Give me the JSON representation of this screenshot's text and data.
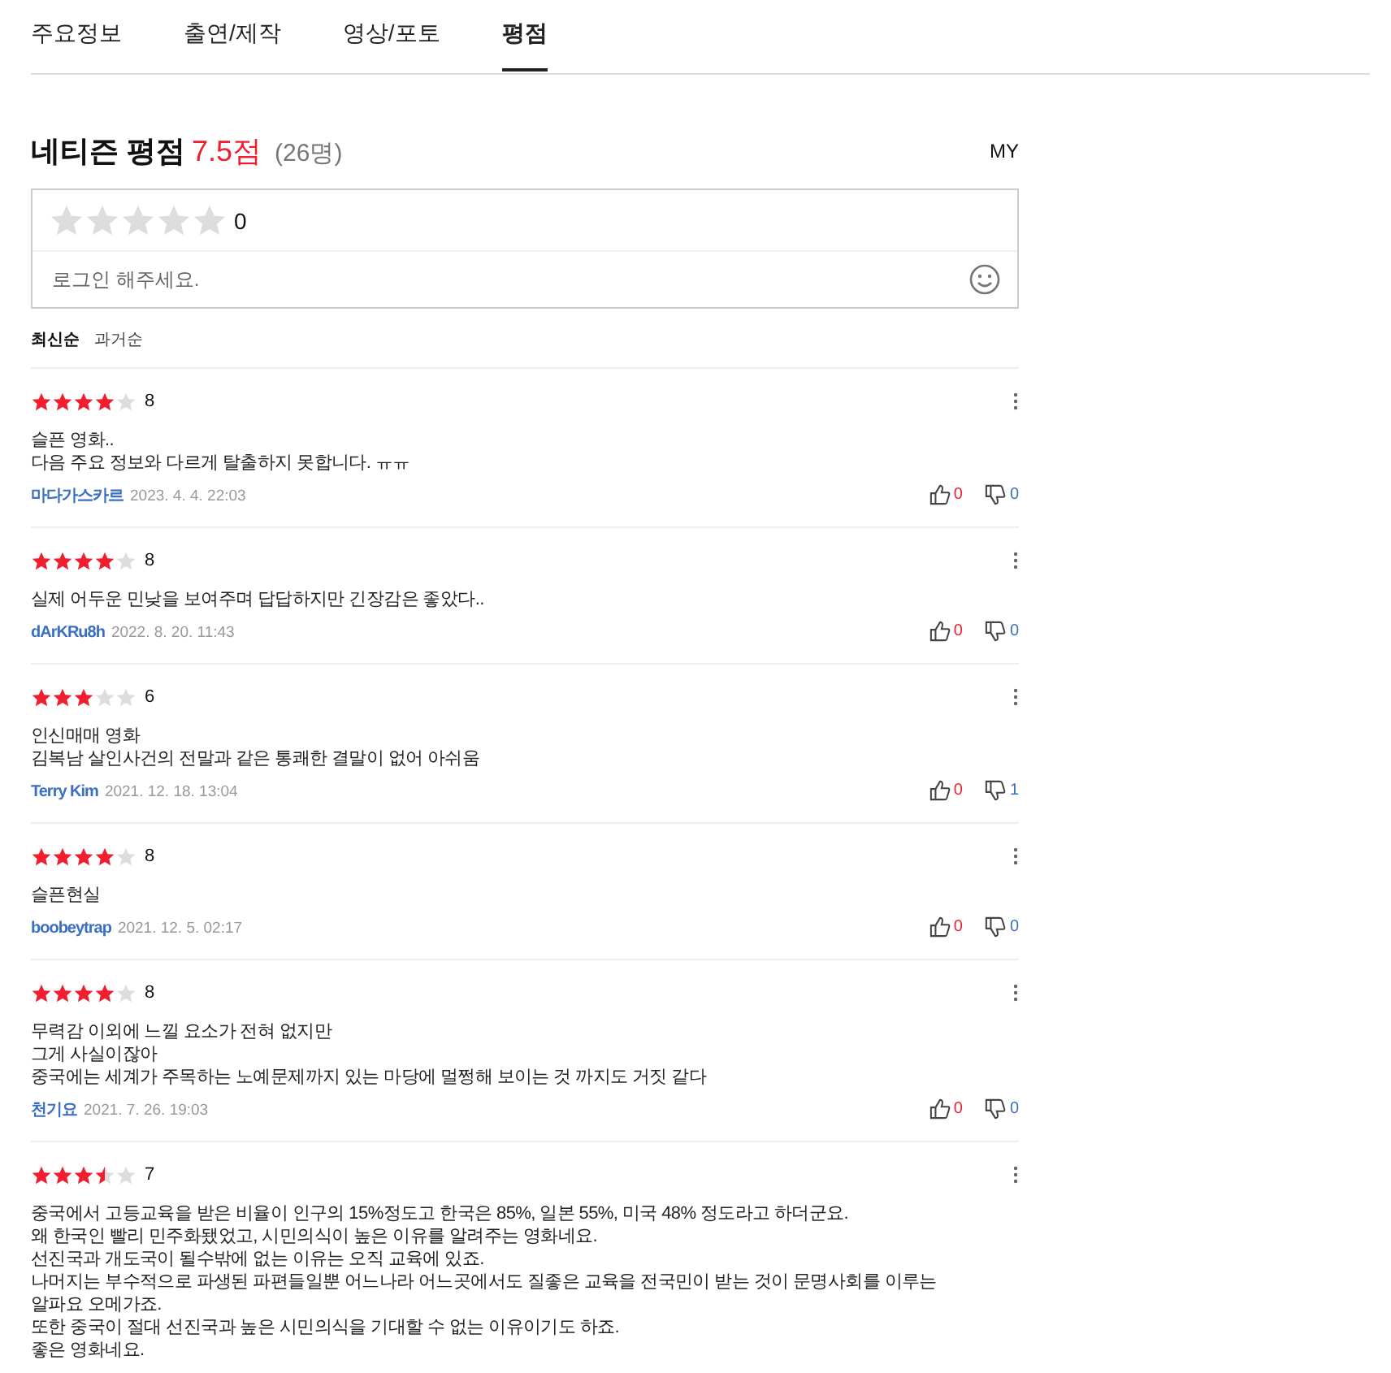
{
  "tabs": [
    {
      "label": "주요정보",
      "selected": false
    },
    {
      "label": "출연/제작",
      "selected": false
    },
    {
      "label": "영상/포토",
      "selected": false
    },
    {
      "label": "평점",
      "selected": true
    }
  ],
  "rating": {
    "title": "네티즌 평점",
    "score": "7.5점",
    "count": "(26명)",
    "my_link": "MY"
  },
  "rating_input": {
    "stars": 0,
    "score": "0",
    "placeholder": "로그인 해주세요."
  },
  "sort": [
    {
      "label": "최신순",
      "selected": true
    },
    {
      "label": "과거순",
      "selected": false
    }
  ],
  "reviews": [
    {
      "stars": 4,
      "score": "8",
      "lines": [
        "슬픈 영화..",
        "다음 주요 정보와 다르게 탈출하지 못합니다. ㅠㅠ"
      ],
      "author": "마다가스카르",
      "date": "2023. 4. 4. 22:03",
      "likes": "0",
      "dislikes": "0"
    },
    {
      "stars": 4,
      "score": "8",
      "lines": [
        "실제 어두운 민낮을 보여주며 답답하지만 긴장감은 좋았다.."
      ],
      "author": "dArKRu8h",
      "date": "2022. 8. 20. 11:43",
      "likes": "0",
      "dislikes": "0"
    },
    {
      "stars": 3,
      "score": "6",
      "lines": [
        "인신매매 영화",
        "김복남 살인사건의 전말과 같은 통쾌한 결말이 없어 아쉬움"
      ],
      "author": "Terry Kim",
      "date": "2021. 12. 18. 13:04",
      "likes": "0",
      "dislikes": "1"
    },
    {
      "stars": 4,
      "score": "8",
      "lines": [
        "슬픈현실"
      ],
      "author": "boobeytrap",
      "date": "2021. 12. 5. 02:17",
      "likes": "0",
      "dislikes": "0"
    },
    {
      "stars": 4,
      "score": "8",
      "lines": [
        "무력감 이외에 느낄 요소가 전혀 없지만",
        "그게 사실이잖아",
        "중국에는 세계가 주목하는 노예문제까지 있는 마당에 멀쩡해 보이는 것 까지도 거짓 같다"
      ],
      "author": "천기요",
      "date": "2021. 7. 26. 19:03",
      "likes": "0",
      "dislikes": "0"
    },
    {
      "stars": 3.5,
      "score": "7",
      "lines": [
        "중국에서 고등교육을 받은 비율이 인구의 15%정도고 한국은 85%, 일본 55%, 미국 48% 정도라고 하더군요.",
        "왜 한국인 빨리 민주화됐었고, 시민의식이 높은 이유를 알려주는 영화네요.",
        "선진국과 개도국이 될수밖에 없는 이유는 오직 교육에 있죠.",
        "나머지는 부수적으로 파생된 파편들일뿐 어느나라 어느곳에서도 질좋은 교육을 전국민이 받는 것이 문명사회를 이루는",
        "알파요 오메가죠.",
        "또한 중국이 절대 선진국과 높은 시민의식을 기대할 수 없는 이유이기도 하죠.",
        "좋은 영화네요."
      ]
    }
  ]
}
